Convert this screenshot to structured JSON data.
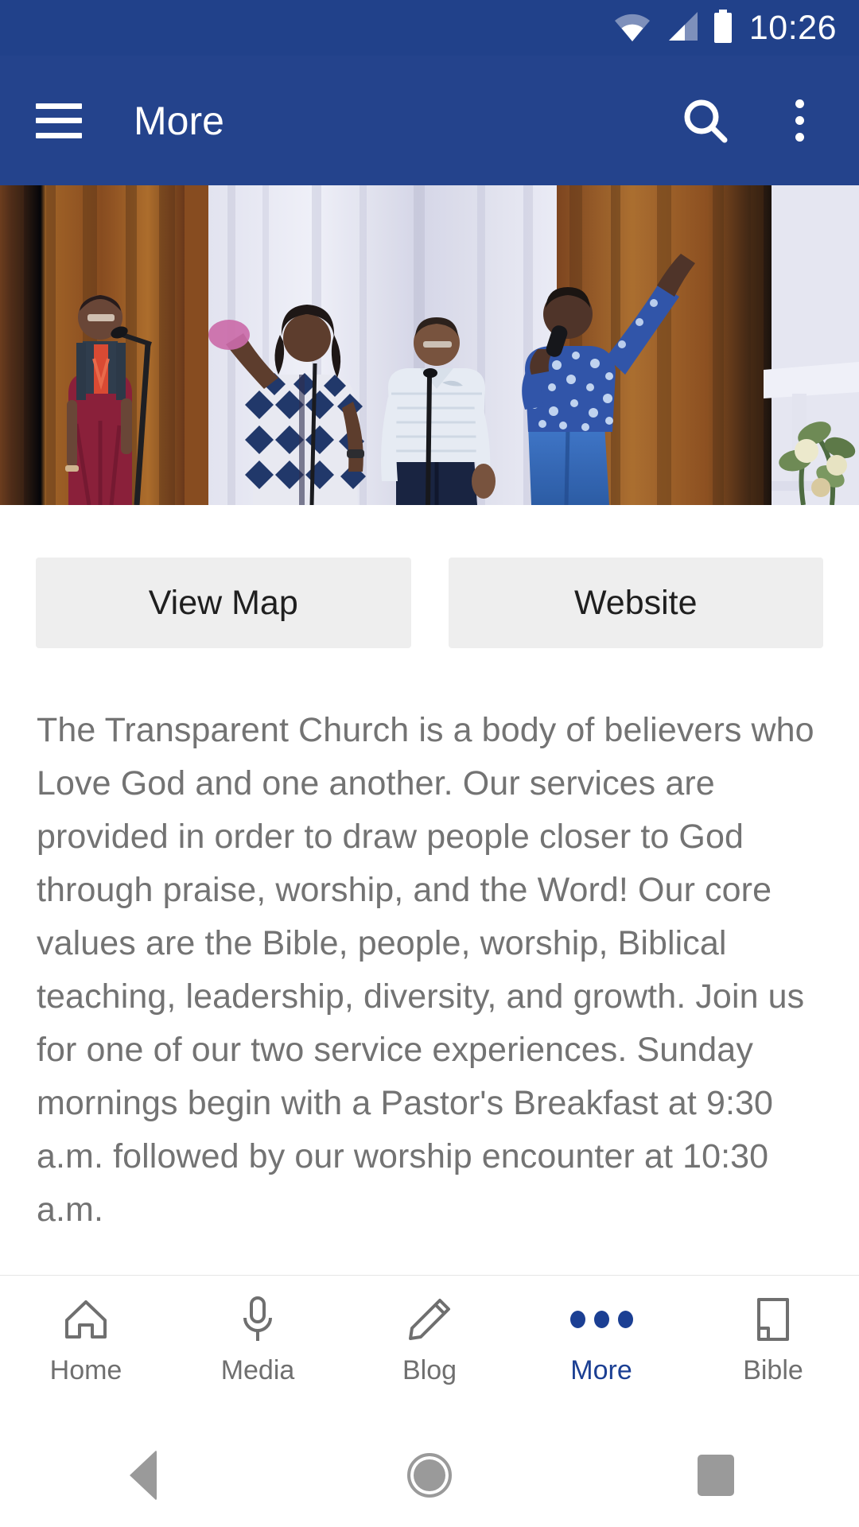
{
  "status_bar": {
    "time": "10:26",
    "icons": [
      "wifi-icon",
      "cell-signal-icon",
      "battery-icon"
    ]
  },
  "app_bar": {
    "menu_icon": "hamburger-menu-icon",
    "title": "More",
    "search_icon": "search-icon",
    "overflow_icon": "more-vert-icon",
    "background_color": "#24438c"
  },
  "hero": {
    "alt": "Worship team singing on stage with microphones in front of curtains"
  },
  "actions": {
    "view_map_label": "View Map",
    "website_label": "Website"
  },
  "about": {
    "text": "The Transparent Church is a body of believers who Love God and one another. Our services are provided in order to draw people closer to God through praise, worship, and the Word! Our core values are the Bible, people, worship, Biblical teaching, leadership, diversity, and growth. Join us for one of our two service experiences. Sunday mornings begin with a Pastor's Breakfast at 9:30 a.m. followed by our worship encounter at 10:30 a.m."
  },
  "bottom_nav": {
    "active_color": "#1b3f93",
    "inactive_color": "#6f6f6f",
    "items": [
      {
        "label": "Home",
        "icon": "home-icon",
        "active": false
      },
      {
        "label": "Media",
        "icon": "microphone-icon",
        "active": false
      },
      {
        "label": "Blog",
        "icon": "pencil-icon",
        "active": false
      },
      {
        "label": "More",
        "icon": "dots-icon",
        "active": true
      },
      {
        "label": "Bible",
        "icon": "book-icon",
        "active": false
      }
    ]
  },
  "system_nav": {
    "back": "back-triangle-icon",
    "home": "home-circle-icon",
    "recents": "recents-square-icon"
  }
}
